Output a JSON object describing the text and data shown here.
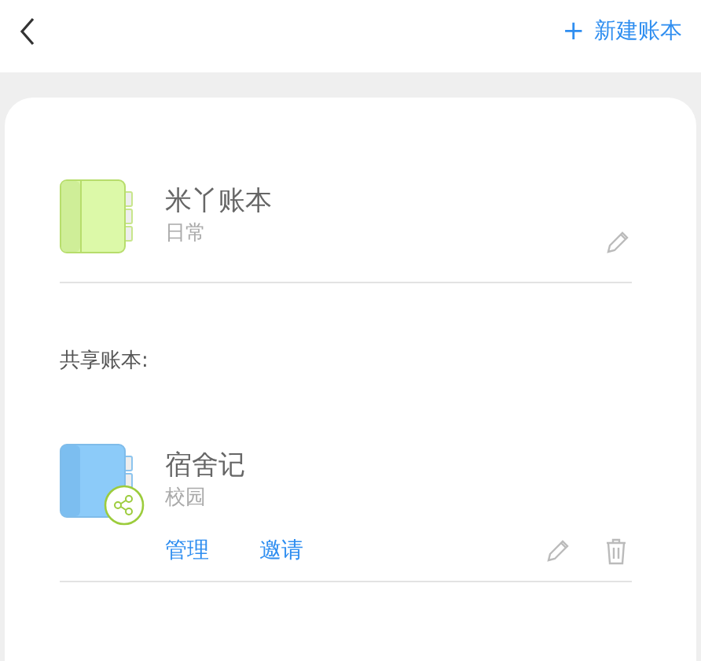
{
  "header": {
    "new_button": {
      "icon": "+",
      "label": "新建账本"
    }
  },
  "my_books": [
    {
      "name": "米丫账本",
      "category": "日常",
      "color": "#dcf9a8",
      "kind": "personal"
    }
  ],
  "shared_section": {
    "title": "共享账本:"
  },
  "shared_books": [
    {
      "name": "宿舍记",
      "category": "校园",
      "color": "#8ccbf9",
      "kind": "shared",
      "actions": [
        "管理",
        "邀请"
      ]
    }
  ]
}
